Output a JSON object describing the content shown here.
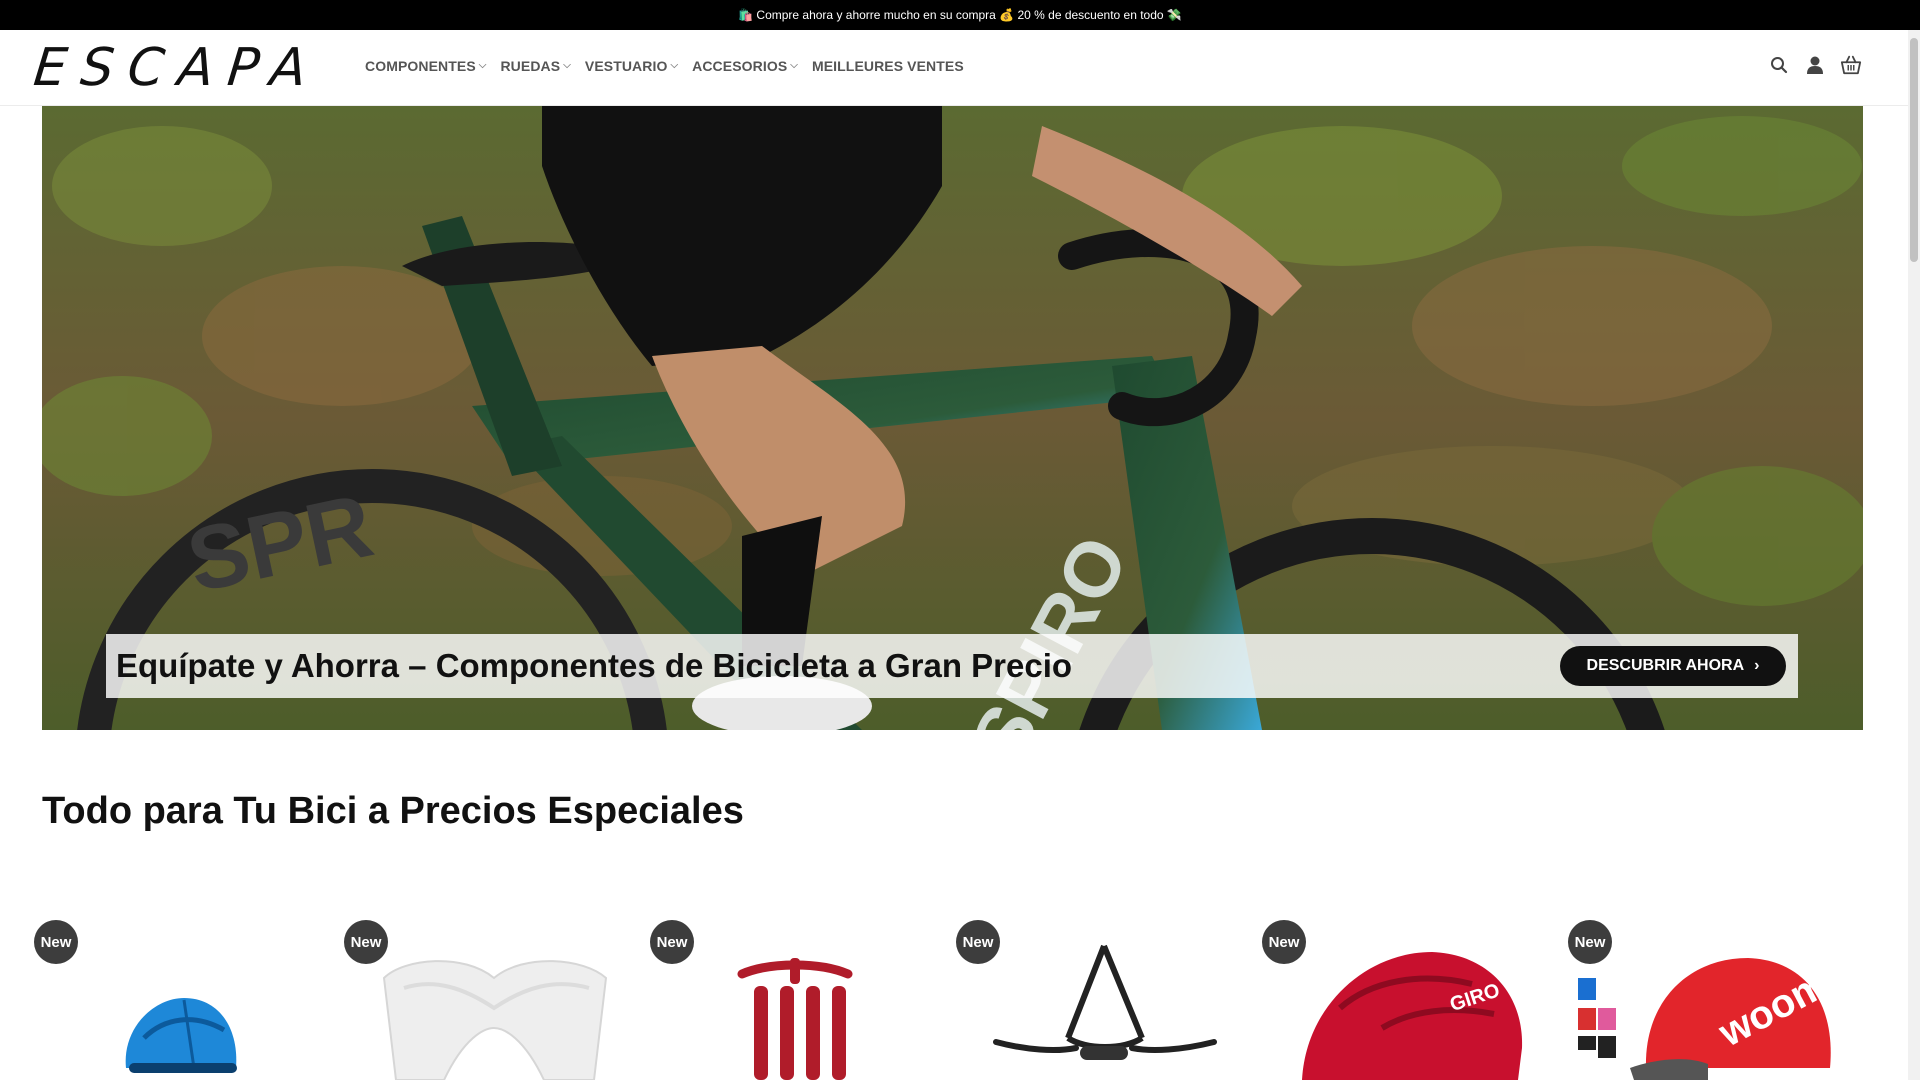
{
  "topbar": {
    "text": "🛍️ Compre ahora y ahorre mucho en su compra 💰 20 % de descuento en todo 💸"
  },
  "header": {
    "logo": "ESCAPA",
    "nav": [
      {
        "label": "COMPONENTES",
        "has_dropdown": true
      },
      {
        "label": "RUEDAS",
        "has_dropdown": true
      },
      {
        "label": "VESTUARIO",
        "has_dropdown": true
      },
      {
        "label": "ACCESORIOS",
        "has_dropdown": true
      },
      {
        "label": "MEILLEURES VENTES",
        "has_dropdown": false
      }
    ],
    "icons": [
      "search-icon",
      "user-icon",
      "basket-icon"
    ]
  },
  "hero": {
    "frame_text": "SPIRO",
    "title": "Equípate y Ahorra – Componentes de Bicicleta a Gran Precio",
    "button_label": "DESCUBRIR AHORA",
    "button_icon": "chevron-right-icon"
  },
  "section": {
    "title": "Todo para Tu Bici a Precios Especiales"
  },
  "products": [
    {
      "badge": "New",
      "image": "blue-kids-helmet"
    },
    {
      "badge": "New",
      "image": "white-helmet-visor"
    },
    {
      "badge": "New",
      "image": "red-helmet-pads"
    },
    {
      "badge": "New",
      "image": "helmet-strap-harness"
    },
    {
      "badge": "New",
      "image": "red-giro-helmet",
      "image_text": "GIRO"
    },
    {
      "badge": "New",
      "image": "red-woom-helmet",
      "image_text": "woom"
    }
  ],
  "colors": {
    "topbar": "#000000",
    "accent": "#111111",
    "badge": "#3d3d3d",
    "helmet_red": "#c8102e",
    "helmet_blue": "#1e88d8"
  }
}
